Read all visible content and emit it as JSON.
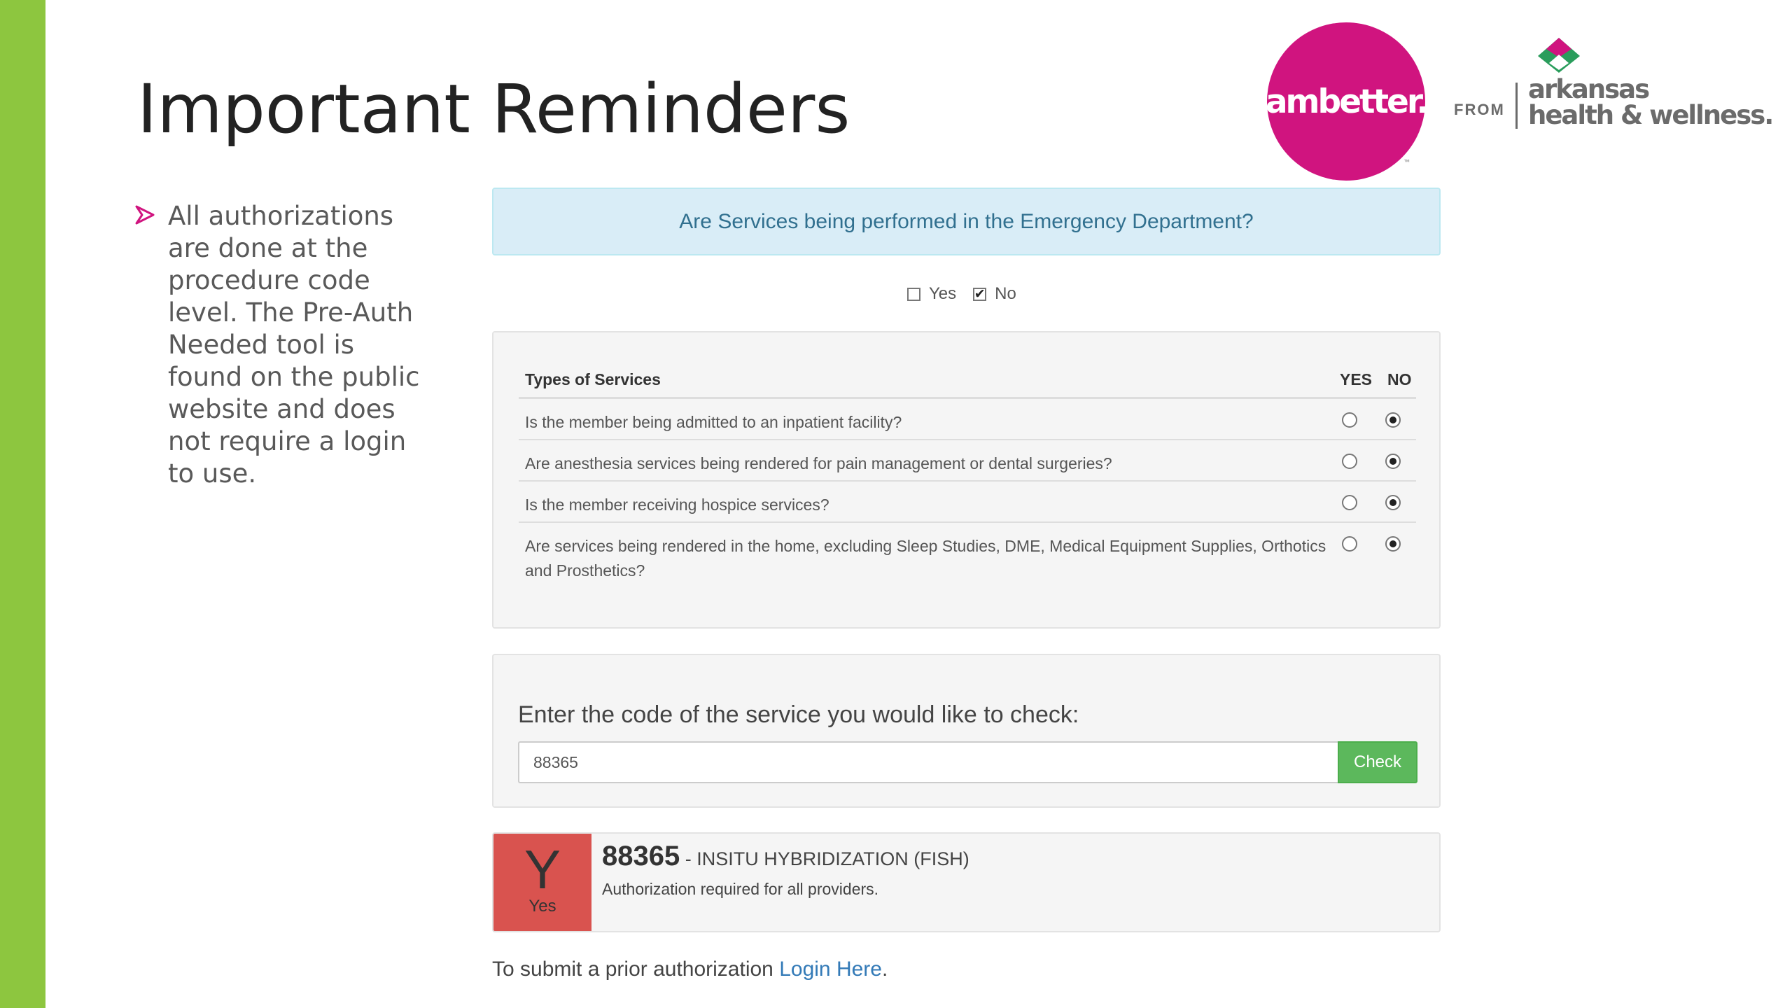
{
  "slide": {
    "title": "Important Reminders",
    "bullet": "All authorizations are done at the procedure code level.  The Pre-Auth Needed tool is found on the public website and does not require a login to use."
  },
  "logo": {
    "brand": "ambetter.",
    "from": "FROM",
    "partner_line1": "arkansas",
    "partner_line2": "health & wellness.",
    "tm": "™"
  },
  "emergency": {
    "question": "Are Services being performed in the Emergency Department?",
    "yes_label": "Yes",
    "no_label": "No",
    "yes_checked": false,
    "no_checked": true
  },
  "services": {
    "header": "Types of Services",
    "yes_col": "YES",
    "no_col": "NO",
    "rows": [
      {
        "question": "Is the member being admitted to an inpatient facility?",
        "answer": "NO"
      },
      {
        "question": "Are anesthesia services being rendered for pain management or dental surgeries?",
        "answer": "NO"
      },
      {
        "question": "Is the member receiving hospice services?",
        "answer": "NO"
      },
      {
        "question": "Are services being rendered in the home, excluding Sleep Studies, DME, Medical Equipment Supplies, Orthotics and Prosthetics?",
        "answer": "NO"
      }
    ]
  },
  "code_check": {
    "prompt": "Enter the code of the service you would like to check:",
    "value": "88365",
    "button": "Check"
  },
  "result": {
    "letter": "Y",
    "label": "Yes",
    "code": "88365",
    "description": " - INSITU HYBRIDIZATION (FISH)",
    "note": "Authorization required for all providers."
  },
  "footer": {
    "text": "To submit a prior authorization ",
    "link": "Login Here",
    "suffix": "."
  },
  "colors": {
    "accent_green": "#8dc63f",
    "brand_magenta": "#d0147f",
    "check_button": "#5cb85c",
    "result_required": "#d9534f",
    "link": "#337ab7"
  }
}
